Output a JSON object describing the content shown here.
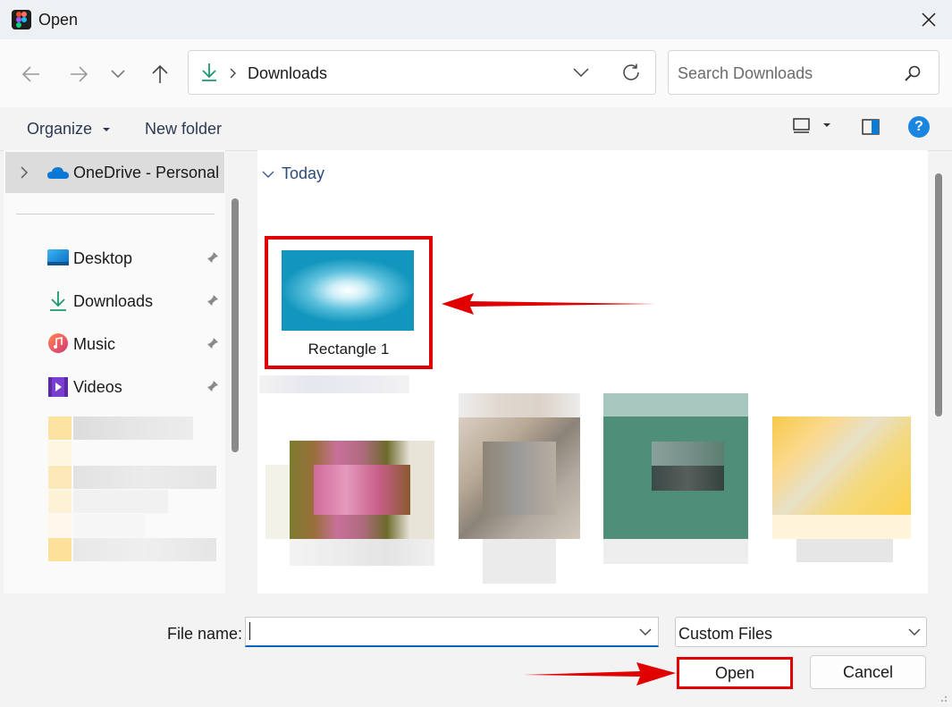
{
  "window": {
    "title": "Open",
    "close_icon": "close-icon",
    "app_icon": "figma-icon"
  },
  "navigation": {
    "back_icon": "arrow-left-icon",
    "forward_icon": "arrow-right-icon",
    "recent_icon": "chevron-down-icon",
    "up_icon": "arrow-up-icon",
    "address": {
      "folder_icon": "download-icon",
      "path": "Downloads",
      "dropdown_icon": "chevron-down-icon",
      "refresh_icon": "refresh-icon"
    },
    "search": {
      "placeholder": "Search Downloads",
      "icon": "search-icon"
    }
  },
  "commandbar": {
    "organize": "Organize",
    "new_folder": "New folder",
    "view_icon": "view-layout-icon",
    "preview_pane_icon": "preview-pane-icon",
    "help_icon": "help-icon",
    "help_glyph": "?"
  },
  "nav_pane": {
    "onedrive": "OneDrive - Personal",
    "items": [
      {
        "label": "Desktop",
        "icon": "desktop-icon",
        "pinned": true
      },
      {
        "label": "Downloads",
        "icon": "download-icon",
        "pinned": true
      },
      {
        "label": "Music",
        "icon": "music-icon",
        "pinned": true
      },
      {
        "label": "Videos",
        "icon": "video-icon",
        "pinned": true
      }
    ]
  },
  "content": {
    "group_label": "Today",
    "files": [
      {
        "name": "Rectangle 1",
        "highlighted": true
      }
    ]
  },
  "footer": {
    "filename_label": "File name:",
    "filename_value": "",
    "filetype": "Custom Files",
    "open_label": "Open",
    "cancel_label": "Cancel"
  },
  "annotation_color": "#e00000"
}
